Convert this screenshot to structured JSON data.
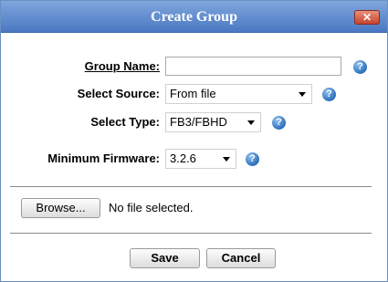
{
  "dialog": {
    "title": "Create Group",
    "close_label": "✕"
  },
  "form": {
    "group_name": {
      "label": "Group Name:",
      "value": ""
    },
    "source": {
      "label": "Select Source:",
      "value": "From file"
    },
    "type": {
      "label": "Select Type:",
      "value": "FB3/FBHD"
    },
    "firmware": {
      "label": "Minimum Firmware:",
      "value": "3.2.6"
    }
  },
  "file": {
    "browse_label": "Browse...",
    "status": "No file selected."
  },
  "actions": {
    "save": "Save",
    "cancel": "Cancel"
  },
  "icons": {
    "help": "question-circle-icon",
    "help_glyph": "?"
  }
}
